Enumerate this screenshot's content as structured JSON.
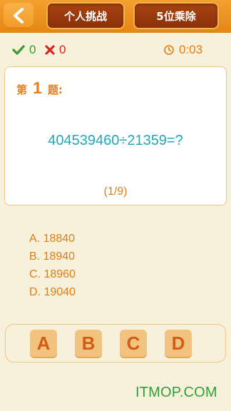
{
  "header": {
    "mode_tab": "个人挑战",
    "level_tab": "5位乘除"
  },
  "stats": {
    "correct_count": "0",
    "wrong_count": "0",
    "timer": "0:03"
  },
  "question": {
    "prefix": "第",
    "number": "1",
    "suffix": "题:",
    "text": "404539460÷21359=?",
    "progress": "(1/9)"
  },
  "options": [
    "A. 18840",
    "B. 18940",
    "C. 18960",
    "D. 19040"
  ],
  "answer_buttons": [
    "A",
    "B",
    "C",
    "D"
  ],
  "watermark": "ITMOP.COM",
  "colors": {
    "accent": "#e07d16",
    "background": "#f7f1dc",
    "correct": "#3a9a2c",
    "wrong": "#d7261d",
    "question_text": "#22a9b8"
  }
}
